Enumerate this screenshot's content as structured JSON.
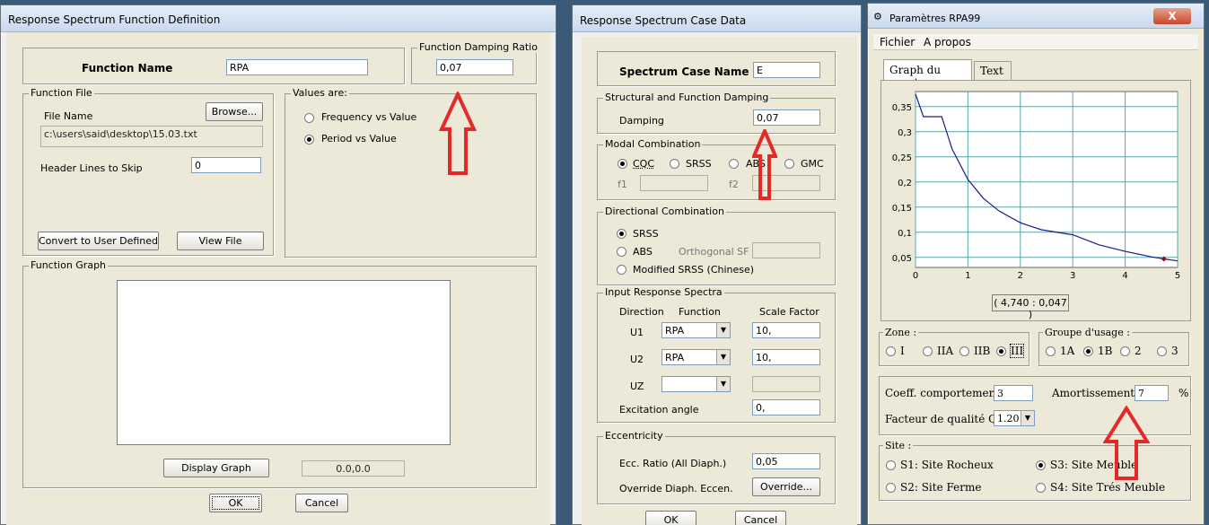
{
  "w1": {
    "title": "Response Spectrum  Function Definition",
    "function_name_label": "Function Name",
    "function_name_value": "RPA",
    "damping_group": "Function Damping Ratio",
    "damping_value": "0,07",
    "function_file_group": "Function File",
    "file_name_label": "File Name",
    "browse_button": "Browse...",
    "file_path": "c:\\users\\said\\desktop\\15.03.txt",
    "header_lines_label": "Header Lines to Skip",
    "header_lines_value": "0",
    "convert_button": "Convert to User Defined",
    "view_file_button": "View File",
    "values_group": "Values are:",
    "freq_option": "Frequency vs Value",
    "period_option": "Period vs Value",
    "graph_group": "Function Graph",
    "display_graph_button": "Display Graph",
    "coord_value": "0.0,0.0",
    "ok_button": "OK",
    "cancel_button": "Cancel"
  },
  "w2": {
    "title": "Response Spectrum Case Data",
    "case_name_label": "Spectrum Case Name",
    "case_name_value": "E",
    "damping_group": "Structural and Function Damping",
    "damping_label": "Damping",
    "damping_value": "0,07",
    "modal_group": "Modal Combination",
    "cqc": "CQC",
    "srss": "SRSS",
    "abs": "ABS",
    "gmc": "GMC",
    "f1": "f1",
    "f2": "f2",
    "directional_group": "Directional Combination",
    "dir_srss": "SRSS",
    "dir_abs": "ABS",
    "orthogonal_sf": "Orthogonal SF",
    "modified_srss": "Modified SRSS (Chinese)",
    "input_group": "Input Response Spectra",
    "direction_hdr": "Direction",
    "function_hdr": "Function",
    "scale_hdr": "Scale Factor",
    "rows": [
      {
        "dir": "U1",
        "func": "RPA",
        "scale": "10,"
      },
      {
        "dir": "U2",
        "func": "RPA",
        "scale": "10,"
      },
      {
        "dir": "UZ",
        "func": "",
        "scale": ""
      }
    ],
    "excitation_label": "Excitation  angle",
    "excitation_value": "0,",
    "eccentricity_group": "Eccentricity",
    "ecc_ratio_label": "Ecc. Ratio (All Diaph.)",
    "ecc_ratio_value": "0,05",
    "override_label": "Override Diaph. Eccen.",
    "override_button": "Override...",
    "ok_button": "OK",
    "cancel_button": "Cancel"
  },
  "w3": {
    "title": "Paramètres RPA99",
    "close": "X",
    "menu": [
      "Fichier",
      "A propos"
    ],
    "tabs": [
      "Graph du spectre",
      "Text"
    ],
    "readout": "( 4,740 : 0,047 )",
    "zone_group": "Zone :",
    "zones": [
      "I",
      "IIA",
      "IIB",
      "III"
    ],
    "usage_group": "Groupe d'usage :",
    "usages": [
      "1A",
      "1B",
      "2",
      "3"
    ],
    "coeff_label": "Coeff. comportement :",
    "coeff_value": "3",
    "amort_label": "Amortissement :",
    "amort_value": "7",
    "amort_unit": "%",
    "qualite_label": "Facteur de qualité Q :",
    "qualite_value": "1.20",
    "site_group": "Site :",
    "sites": [
      "S1: Site Rocheux",
      "S3: Site Meuble",
      "S2: Site Ferme",
      "S4: Site Trés Meuble"
    ]
  },
  "chart_data": {
    "type": "line",
    "title": "",
    "xlabel": "",
    "ylabel": "",
    "xlim": [
      0,
      5
    ],
    "ylim": [
      0.03,
      0.38
    ],
    "x_ticks": [
      "0",
      "1",
      "2",
      "3",
      "4",
      "5"
    ],
    "y_ticks": [
      "0,05",
      "0,1",
      "0,15",
      "0,2",
      "0,25",
      "0,3",
      "0,35"
    ],
    "grid": true,
    "series": [
      {
        "x": [
          0,
          0.15,
          0.5,
          0.7,
          1,
          1.3,
          1.6,
          2,
          2.4,
          3,
          3.5,
          4,
          4.5,
          4.74,
          5
        ],
        "y": [
          0.375,
          0.33,
          0.33,
          0.265,
          0.205,
          0.167,
          0.142,
          0.119,
          0.105,
          0.095,
          0.075,
          0.062,
          0.051,
          0.047,
          0.043
        ]
      }
    ],
    "marker": {
      "x": 4.74,
      "y": 0.047
    }
  }
}
